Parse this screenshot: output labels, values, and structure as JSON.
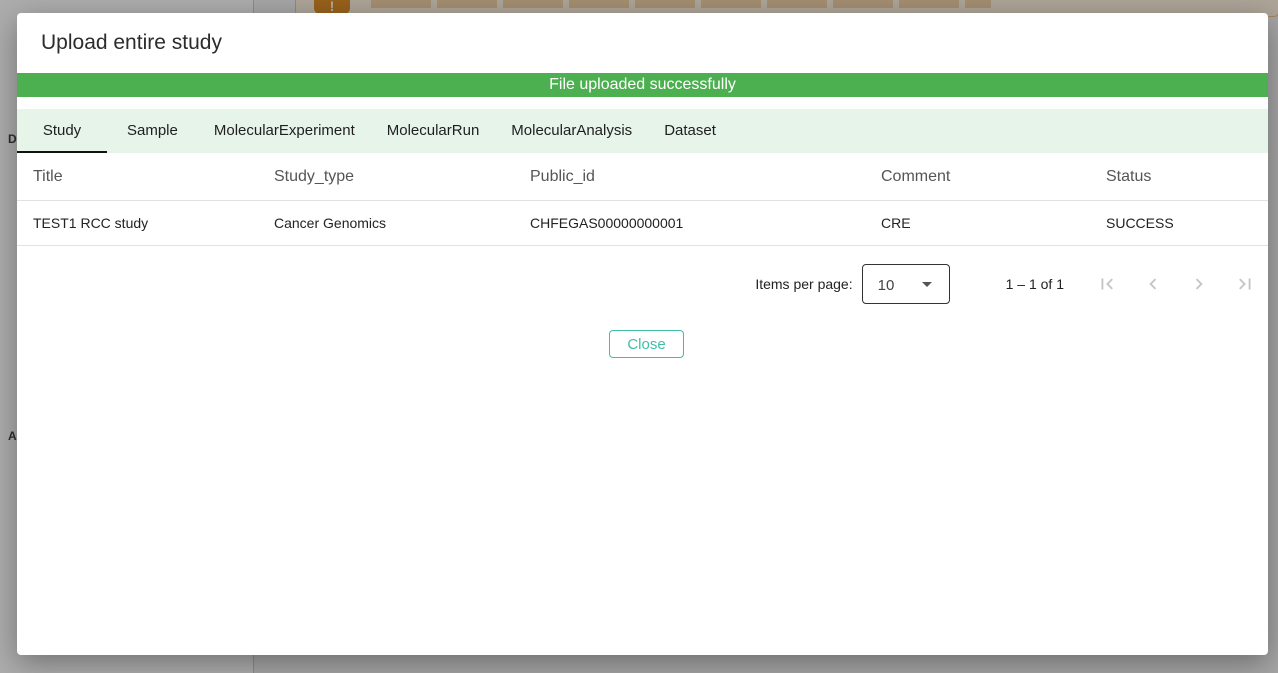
{
  "dialog": {
    "title": "Upload entire study",
    "success_message": "File uploaded successfully",
    "success_color": "#4caf50",
    "close_label": "Close"
  },
  "tabs": [
    {
      "label": "Study",
      "active": true
    },
    {
      "label": "Sample",
      "active": false
    },
    {
      "label": "MolecularExperiment",
      "active": false
    },
    {
      "label": "MolecularRun",
      "active": false
    },
    {
      "label": "MolecularAnalysis",
      "active": false
    },
    {
      "label": "Dataset",
      "active": false
    }
  ],
  "table": {
    "columns": [
      "Title",
      "Study_type",
      "Public_id",
      "Comment",
      "Status"
    ],
    "rows": [
      [
        "TEST1 RCC study",
        "Cancer Genomics",
        "CHFEGAS00000000001",
        "CRE",
        "SUCCESS"
      ]
    ]
  },
  "paginator": {
    "items_per_page_label": "Items per page:",
    "items_per_page_value": "10",
    "range_label": "1 – 1 of 1"
  },
  "background": {
    "sidebar_letters": [
      "D",
      "A"
    ]
  }
}
